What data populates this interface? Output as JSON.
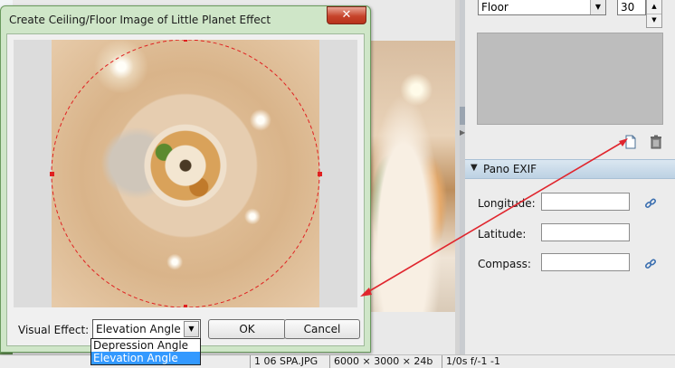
{
  "dialog": {
    "title": "Create Ceiling/Floor Image of Little Planet Effect",
    "close_glyph": "✕",
    "visual_effect_label": "Visual Effect:",
    "visual_effect_selected": "Elevation Angle",
    "visual_effect_options": [
      "Depression Angle",
      "Elevation Angle"
    ],
    "ok_label": "OK",
    "cancel_label": "Cancel"
  },
  "right_panel": {
    "view_select": "Floor",
    "view_value": "30",
    "exif_section_title": "Pano EXIF",
    "exif_fields": [
      {
        "label": "Longitude:",
        "value": ""
      },
      {
        "label": "Latitude:",
        "value": ""
      },
      {
        "label": "Compass:",
        "value": ""
      }
    ]
  },
  "statusbar": {
    "filename": "1 06 SPA.JPG",
    "dimensions": "6000 × 3000 × 24b",
    "exposure": "1/0s f/-1 -1"
  },
  "colors": {
    "accent_selection": "#3399ff",
    "dashed_circle": "#e02020",
    "annotation_arrow": "#e0262e",
    "dialog_frame": "#cfe6c8"
  },
  "icons": {
    "new_page": "page-icon",
    "delete": "trash-icon",
    "link": "link-icon"
  }
}
